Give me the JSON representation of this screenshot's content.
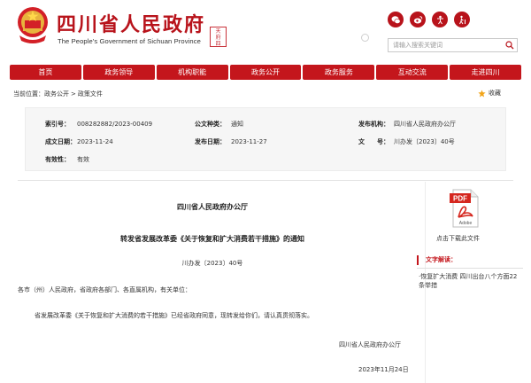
{
  "header": {
    "site_title": "四川省人民政府",
    "site_subtitle": "The People's Government of Sichuan Province",
    "seal_chars": [
      "天",
      "府",
      "四",
      "川"
    ],
    "icons": [
      "wechat-icon",
      "weibo-icon",
      "accessibility-icon",
      "elder-mode-icon"
    ],
    "search_placeholder": "请输入搜索关键词"
  },
  "nav": {
    "items": [
      "首页",
      "政务领导",
      "机构职能",
      "政务公开",
      "政务服务",
      "互动交流",
      "走进四川"
    ]
  },
  "breadcrumb": {
    "prefix": "当前位置：",
    "items": [
      "政务公开",
      "政策文件"
    ],
    "separator": ">",
    "favorite_label": "收藏"
  },
  "meta": {
    "index_no_label": "索引号：",
    "index_no": "008282882/2023-00409",
    "doc_type_label": "公文种类：",
    "doc_type": "通知",
    "issuer_label": "发布机构：",
    "issuer": "四川省人民政府办公厅",
    "created_label": "成文日期：",
    "created": "2023-11-24",
    "published_label": "发布日期：",
    "published": "2023-11-27",
    "doc_no_label": "文　　号：",
    "doc_no": "川办发〔2023〕40号",
    "validity_label": "有效性：",
    "validity": "有效"
  },
  "article": {
    "issuer": "四川省人民政府办公厅",
    "title": "转发省发展改革委《关于恢复和扩大消费若干措施》的通知",
    "doc_no": "川办发〔2023〕40号",
    "address": "各市（州）人民政府，省政府各部门、各直属机构，有关单位：",
    "body": "省发展改革委《关于恢复和扩大消费的若干措施》已经省政府同意，现转发给你们，请认真贯彻落实。",
    "signature": "四川省人民政府办公厅",
    "date": "2023年11月24日"
  },
  "sidebar": {
    "pdf_label": "Adobe",
    "pdf_badge": "PDF",
    "download_label": "点击下载此文件",
    "interpretation_heading": "文字解读：",
    "interpretation_link": "·恢复扩大消费 四川出台八个方面22条举措"
  },
  "colors": {
    "brand_red": "#c4161c",
    "title_red": "#b8131b",
    "meta_bg": "#f6f6f6"
  }
}
